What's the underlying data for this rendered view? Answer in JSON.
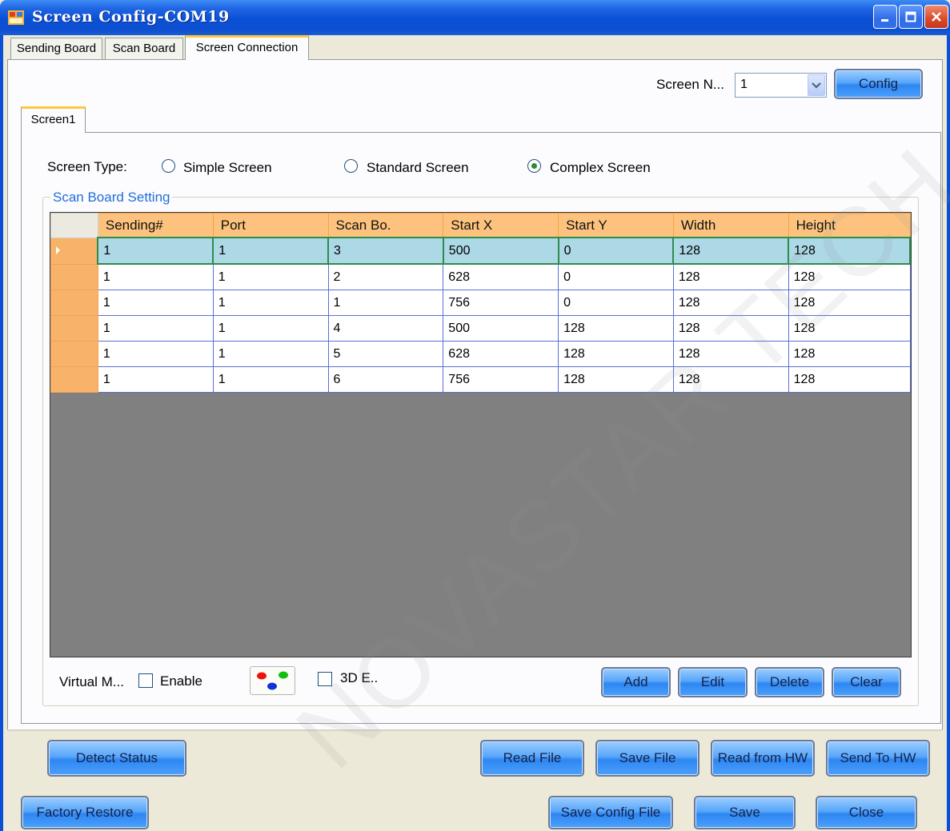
{
  "window": {
    "title": "Screen Config-COM19",
    "icons": [
      "app-icon",
      "minimize-icon",
      "maximize-icon",
      "close-icon"
    ]
  },
  "top_tabs": [
    {
      "label": "Sending Board",
      "active": false
    },
    {
      "label": "Scan Board",
      "active": false
    },
    {
      "label": "Screen Connection",
      "active": true
    }
  ],
  "screen_selector": {
    "label": "Screen N...",
    "value": "1",
    "config_button": "Config"
  },
  "inner_tab": "Screen1",
  "screen_type": {
    "label": "Screen Type:",
    "options": [
      {
        "label": "Simple Screen",
        "selected": false
      },
      {
        "label": "Standard Screen",
        "selected": false
      },
      {
        "label": "Complex Screen",
        "selected": true
      }
    ]
  },
  "scan_board_setting": {
    "title": "Scan Board Setting",
    "columns": [
      "Sending#",
      "Port",
      "Scan Bo.",
      "Start X",
      "Start Y",
      "Width",
      "Height"
    ],
    "selected_row": 0,
    "rows": [
      [
        "1",
        "1",
        "3",
        "500",
        "0",
        "128",
        "128"
      ],
      [
        "1",
        "1",
        "2",
        "628",
        "0",
        "128",
        "128"
      ],
      [
        "1",
        "1",
        "1",
        "756",
        "0",
        "128",
        "128"
      ],
      [
        "1",
        "1",
        "4",
        "500",
        "128",
        "128",
        "128"
      ],
      [
        "1",
        "1",
        "5",
        "628",
        "128",
        "128",
        "128"
      ],
      [
        "1",
        "1",
        "6",
        "756",
        "128",
        "128",
        "128"
      ]
    ]
  },
  "grid_controls": {
    "virtual_label": "Virtual M...",
    "enable_label": "Enable",
    "enable_checked": false,
    "threed_label": "3D E..",
    "threed_checked": false,
    "buttons": [
      "Add",
      "Edit",
      "Delete",
      "Clear"
    ]
  },
  "footer_row1": {
    "detect_status": "Detect Status",
    "read_file": "Read File",
    "save_file": "Save File",
    "read_from_hw": "Read from HW",
    "send_to_hw": "Send To HW"
  },
  "footer_row2": {
    "factory_restore": "Factory Restore",
    "save_config_file": "Save Config File",
    "save": "Save",
    "close": "Close"
  },
  "watermark": "NOVASTAR TECH CO., L",
  "colors": {
    "title_bar": "#0a50d6",
    "tab_highlight": "#ffc83c",
    "grid_header": "#fdc37e",
    "selected_row": "#add8e6",
    "button": "#58a6fa"
  }
}
